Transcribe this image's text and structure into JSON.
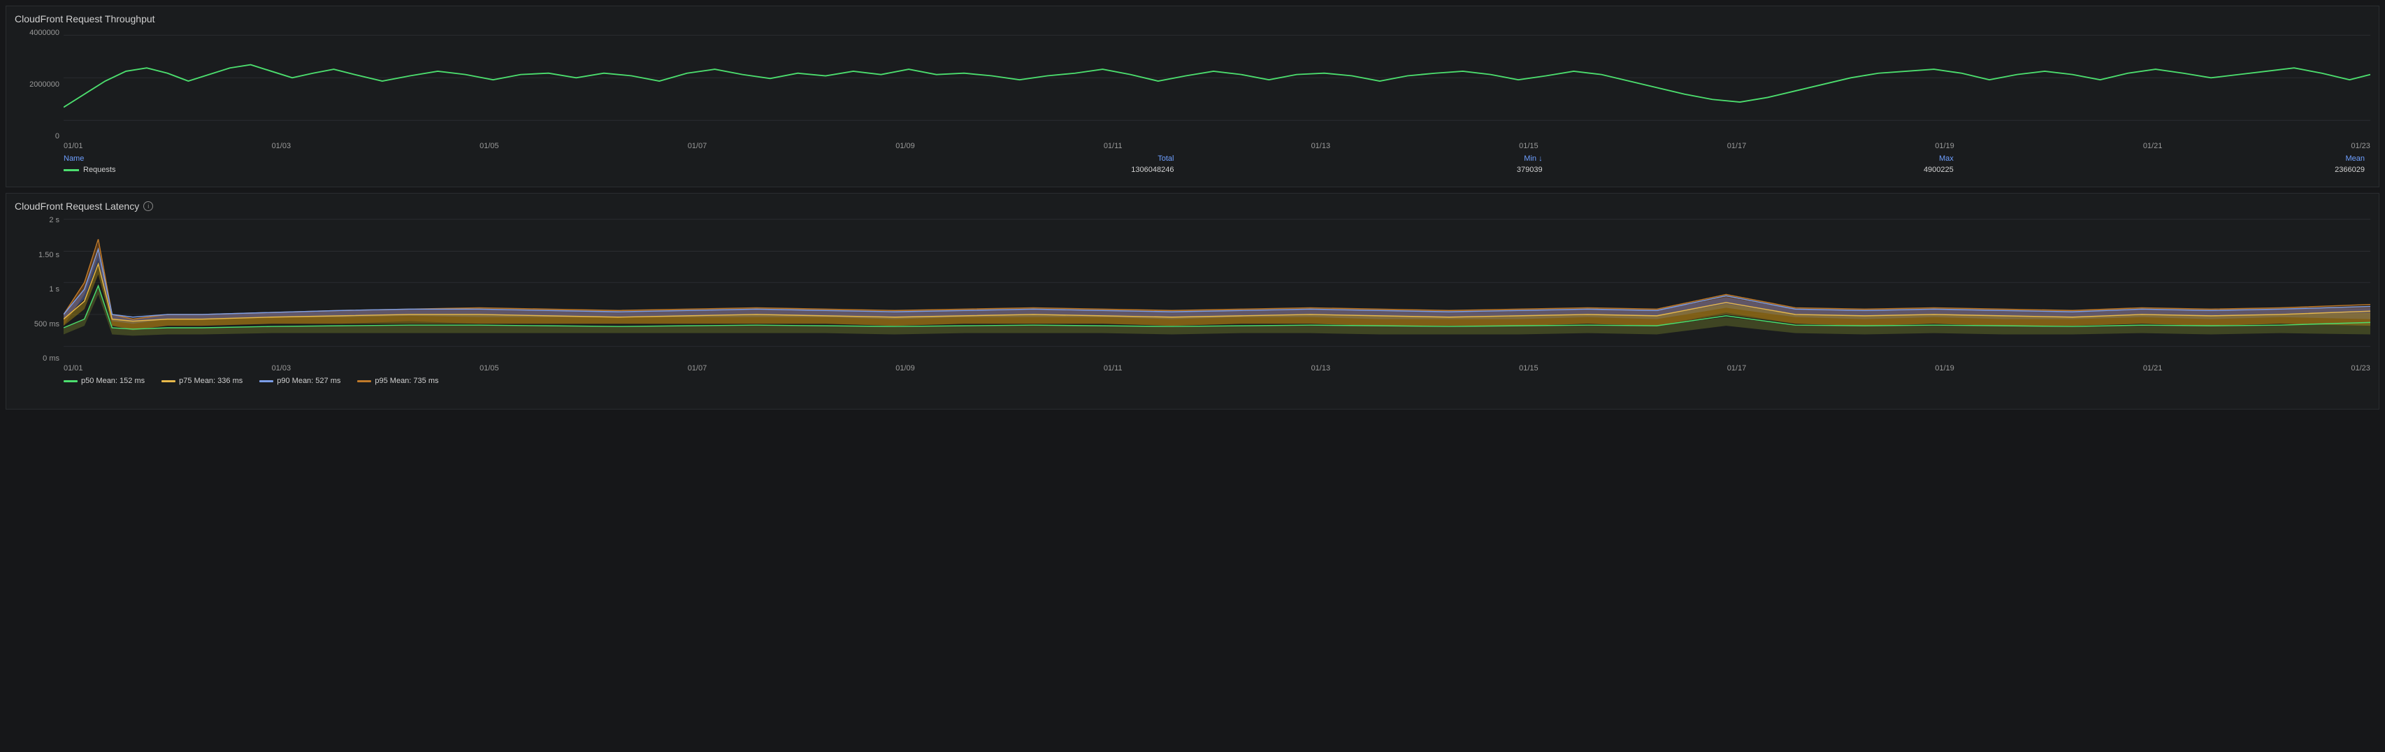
{
  "throughput_panel": {
    "title": "CloudFront Request Throughput",
    "y_axis": [
      "4000000",
      "2000000",
      "0"
    ],
    "x_axis": [
      "01/01",
      "01/03",
      "01/05",
      "01/07",
      "01/09",
      "01/11",
      "01/13",
      "01/15",
      "01/17",
      "01/19",
      "01/21",
      "01/23"
    ],
    "legend": {
      "columns": [
        "Name",
        "Total",
        "Min ↓",
        "Max",
        "Mean"
      ],
      "rows": [
        {
          "color": "#4cde6e",
          "name": "Requests",
          "total": "1306048246",
          "min": "379039",
          "max": "4900225",
          "mean": "2366029"
        }
      ]
    }
  },
  "latency_panel": {
    "title": "CloudFront Request Latency",
    "has_info": true,
    "y_axis": [
      "2 s",
      "1.50 s",
      "1 s",
      "500 ms",
      "0 ms"
    ],
    "x_axis": [
      "01/01",
      "01/03",
      "01/05",
      "01/07",
      "01/09",
      "01/11",
      "01/13",
      "01/15",
      "01/17",
      "01/19",
      "01/21",
      "01/23"
    ],
    "legend": [
      {
        "color": "#4cde6e",
        "label": "p50",
        "mean": "152 ms"
      },
      {
        "color": "#e6b84a",
        "label": "p75",
        "mean": "336 ms"
      },
      {
        "color": "#7b9ee8",
        "label": "p90",
        "mean": "527 ms"
      },
      {
        "color": "#c07a2a",
        "label": "p95",
        "mean": "735 ms"
      }
    ]
  }
}
